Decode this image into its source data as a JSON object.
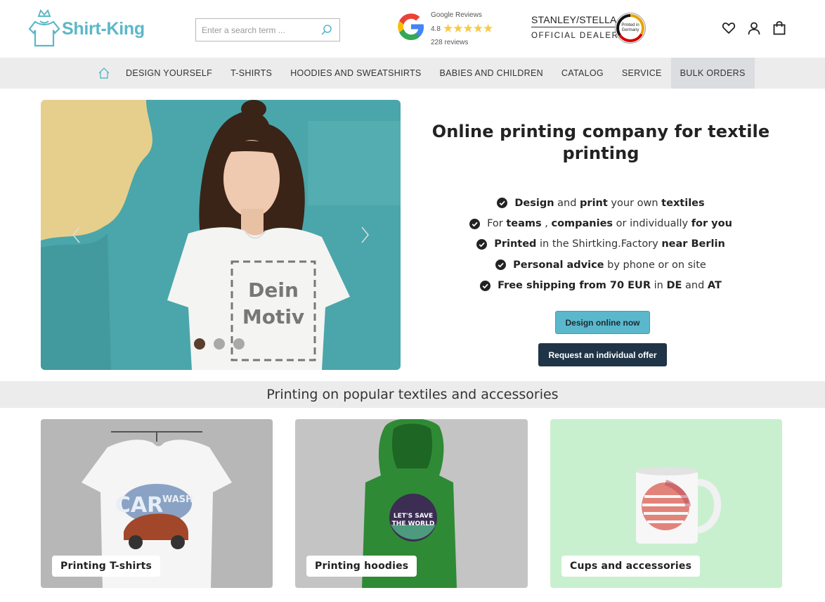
{
  "header": {
    "logo_text": "Shirt-King",
    "search_placeholder": "Enter a search term ...",
    "google": {
      "title": "Google Reviews",
      "rating": "4.8",
      "stars": "★★★★★",
      "count": "228 reviews"
    },
    "dealer": {
      "brand": "STANLEY/STELLA",
      "sub": "OFFICIAL DEALER",
      "badge": "Printed in Germany"
    }
  },
  "nav": {
    "items": [
      {
        "label": "DESIGN YOURSELF"
      },
      {
        "label": "T-SHIRTS"
      },
      {
        "label": "HOODIES AND SWEATSHIRTS"
      },
      {
        "label": "BABIES AND CHILDREN"
      },
      {
        "label": "CATALOG"
      },
      {
        "label": "SERVICE"
      },
      {
        "label": "BULK ORDERS"
      }
    ]
  },
  "hero": {
    "image_text_line1": "Dein",
    "image_text_line2": "Motiv",
    "title": "Online printing company for textile printing",
    "features": [
      {
        "parts": [
          [
            "b",
            "Design"
          ],
          [
            "t",
            " and "
          ],
          [
            "b",
            "print"
          ],
          [
            "t",
            " your own "
          ],
          [
            "b",
            "textiles"
          ]
        ]
      },
      {
        "parts": [
          [
            "t",
            "For "
          ],
          [
            "b",
            "teams"
          ],
          [
            "t",
            " , "
          ],
          [
            "b",
            "companies"
          ],
          [
            "t",
            " or individually "
          ],
          [
            "b",
            "for you"
          ]
        ]
      },
      {
        "parts": [
          [
            "b",
            "Printed"
          ],
          [
            "t",
            " in the Shirtking.Factory "
          ],
          [
            "b",
            "near Berlin"
          ]
        ]
      },
      {
        "parts": [
          [
            "b",
            "Personal advice"
          ],
          [
            "t",
            " by phone or on site"
          ]
        ]
      },
      {
        "parts": [
          [
            "b",
            "Free shipping from 70 EUR"
          ],
          [
            "t",
            " in "
          ],
          [
            "b",
            "DE"
          ],
          [
            "t",
            " and "
          ],
          [
            "b",
            "AT"
          ]
        ]
      }
    ],
    "btn_primary": "Design online now",
    "btn_dark": "Request an individual offer"
  },
  "section": {
    "title": "Printing on popular textiles and accessories",
    "cards": [
      {
        "label": "Printing T-shirts",
        "art_text1": "CAR",
        "art_text2": "WASH"
      },
      {
        "label": "Printing hoodies",
        "art_text1": "LET'S SAVE",
        "art_text2": "THE WORLD"
      },
      {
        "label": "Cups and accessories"
      }
    ]
  },
  "colors": {
    "brand": "#5bb8c8",
    "dark": "#1f3446",
    "nav_bg": "#ececec"
  }
}
